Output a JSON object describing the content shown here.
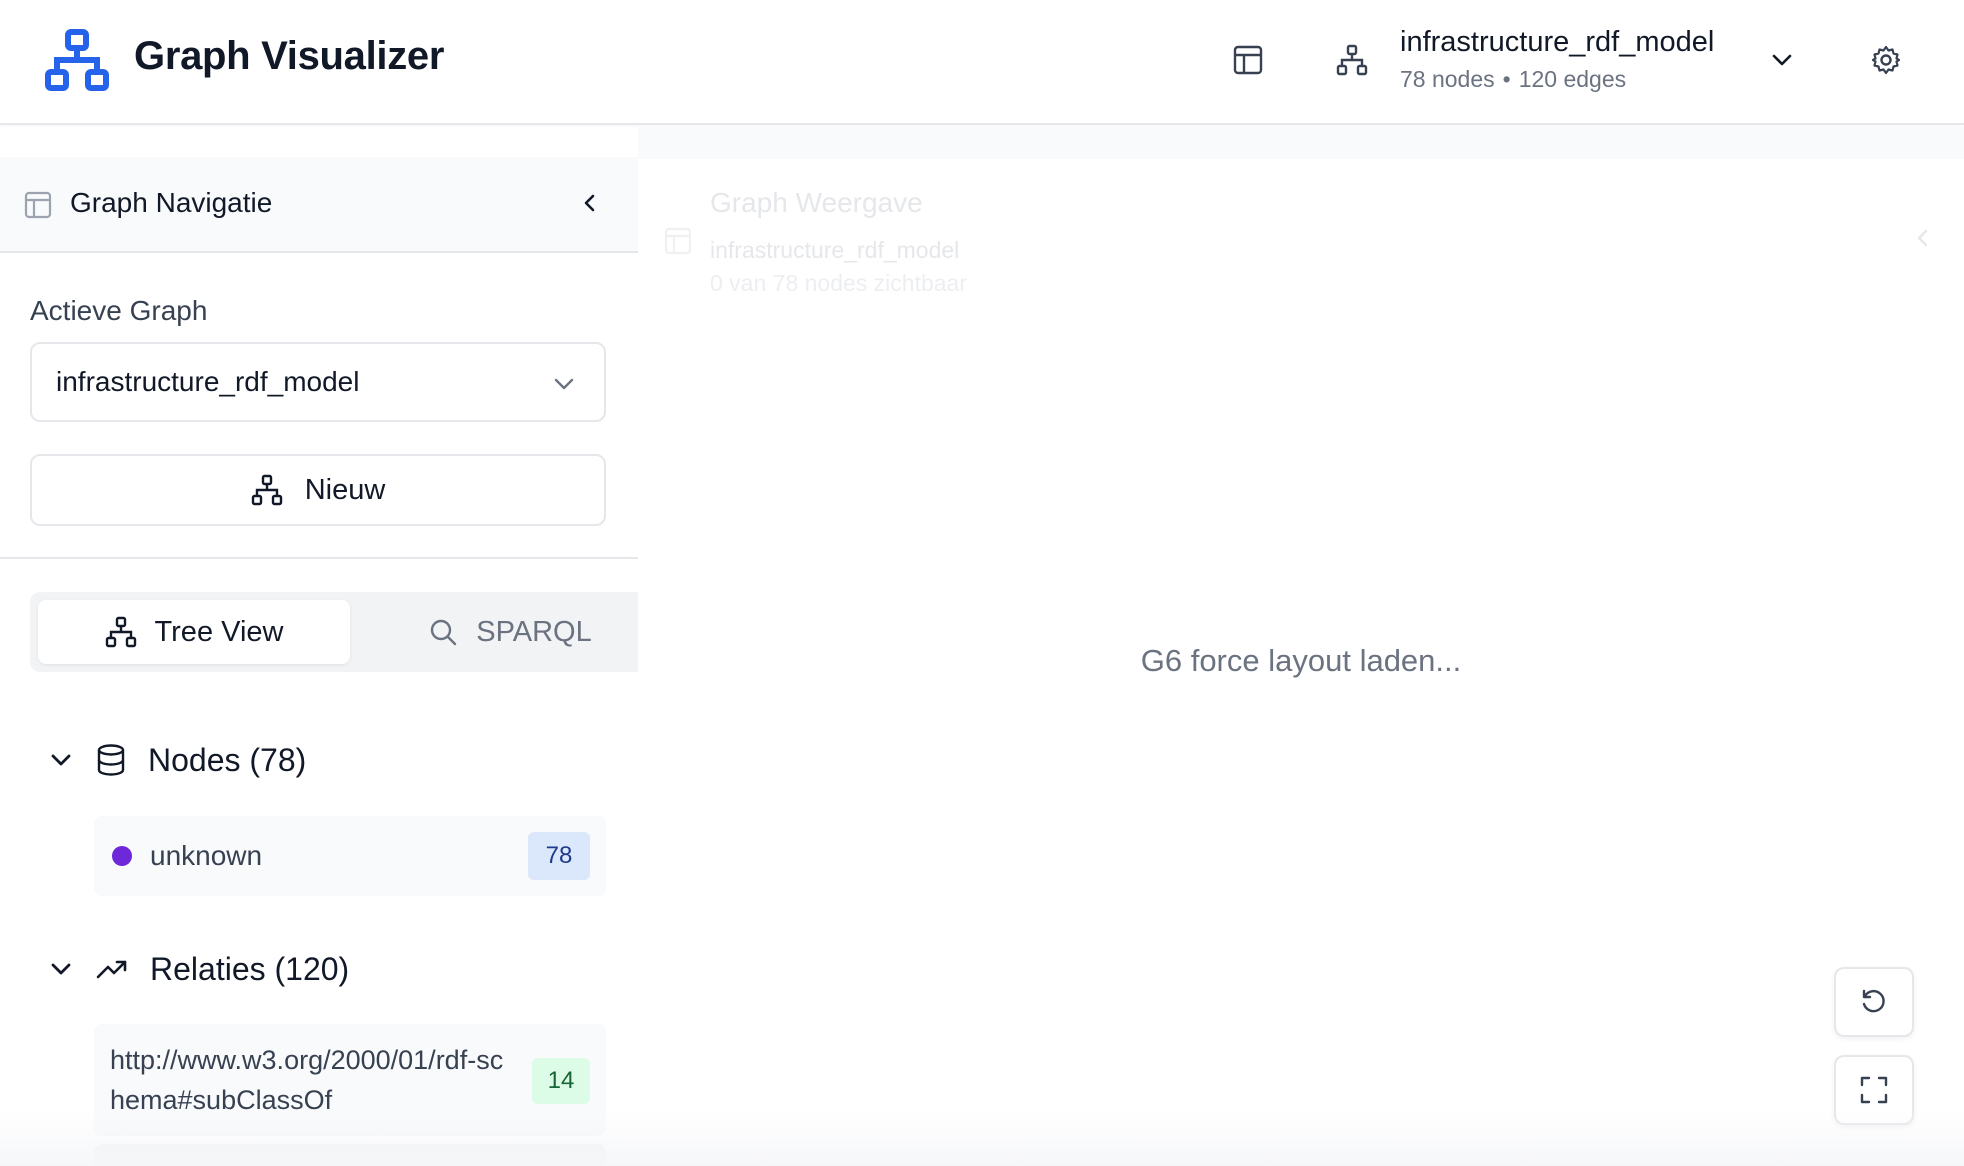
{
  "header": {
    "app_title": "Graph Visualizer",
    "graph_name": "infrastructure_rdf_model",
    "node_count": "78 nodes",
    "stats_separator": "•",
    "edge_count": "120 edges",
    "icons": [
      "graph-logo-icon",
      "layout-icon",
      "sitemap-icon",
      "chevron-down-icon",
      "settings-gear-icon"
    ]
  },
  "sidebar": {
    "title": "Graph Navigatie",
    "active_graph_label": "Actieve Graph",
    "active_graph_value": "infrastructure_rdf_model",
    "new_button_label": "Nieuw",
    "tabs": [
      {
        "label": "Tree View",
        "active": true
      },
      {
        "label": "SPARQL",
        "active": false
      }
    ],
    "nodes_section": {
      "title": "Nodes (78)",
      "items": [
        {
          "label": "unknown",
          "count": "78",
          "color": "#6d28d9"
        }
      ]
    },
    "relations_section": {
      "title": "Relaties (120)",
      "items": [
        {
          "label": "http://www.w3.org/2000/01/rdf-schema#subClassOf",
          "count": "14"
        }
      ]
    }
  },
  "main": {
    "ghost_title": "Graph Weergave",
    "ghost_graph": "infrastructure_rdf_model",
    "ghost_visible": "0 van 78 nodes zichtbaar",
    "loading_text": "G6 force layout laden..."
  },
  "colors": {
    "accent_blue": "#2563eb",
    "node_purple": "#6d28d9",
    "badge_blue_bg": "#dbe7fb",
    "badge_green_bg": "#dcfce7"
  }
}
